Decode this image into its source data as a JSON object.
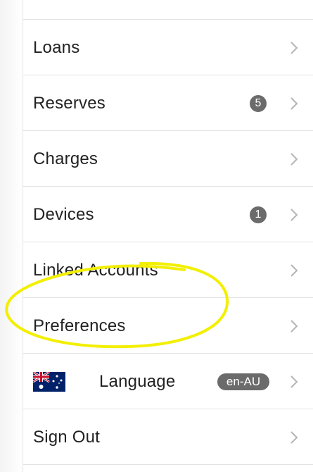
{
  "menu": {
    "items": [
      {
        "key": "loans",
        "label": "Loans"
      },
      {
        "key": "reserves",
        "label": "Reserves",
        "badge": "5"
      },
      {
        "key": "charges",
        "label": "Charges"
      },
      {
        "key": "devices",
        "label": "Devices",
        "badge": "1"
      },
      {
        "key": "linked-accounts",
        "label": "Linked Accounts"
      },
      {
        "key": "preferences",
        "label": "Preferences"
      },
      {
        "key": "language",
        "label": "Language",
        "badge": "en-AU",
        "icon": "australia-flag-icon"
      },
      {
        "key": "sign-out",
        "label": "Sign Out"
      }
    ],
    "chevron_icon": "chevron-right-icon"
  },
  "annotation": {
    "highlighted_item": "preferences",
    "color": "#f2ef00"
  },
  "colors": {
    "text": "#222222",
    "badge_bg": "#6b6b6b",
    "divider": "#e2e2e2",
    "chevron": "#b5b5b5"
  }
}
